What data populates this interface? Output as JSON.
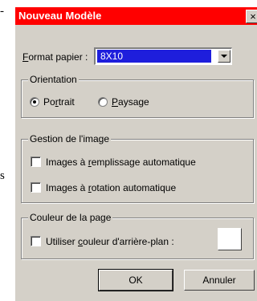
{
  "edge_fragments": [
    "-",
    "s"
  ],
  "dialog": {
    "title": "Nouveau Modèle",
    "close_label": "×",
    "format": {
      "label": "Format papier :",
      "accel": "F",
      "label_rest": "ormat papier :",
      "value": "8X10"
    },
    "orientation": {
      "title": "Orientation",
      "portrait": {
        "label_pre": "Po",
        "accel": "r",
        "label_post": "trait",
        "selected": true
      },
      "landscape": {
        "label_pre": "",
        "accel": "P",
        "label_post": "aysage",
        "selected": false
      }
    },
    "image_management": {
      "title": "Gestion de l'image",
      "auto_fill": {
        "label_pre": "Images à ",
        "accel": "r",
        "label_post": "emplissage automatique",
        "checked": false
      },
      "auto_rotate": {
        "label_pre": "Images à ",
        "accel": "r",
        "label_post": "otation automatique",
        "checked": false
      }
    },
    "page_color": {
      "title": "Couleur de la page",
      "use_bg": {
        "label_pre": "Utiliser ",
        "accel": "c",
        "label_post": "ouleur d'arrière-plan :",
        "checked": false
      },
      "swatch_color": "#ffffff"
    },
    "buttons": {
      "ok": "OK",
      "cancel": "Annuler"
    }
  }
}
